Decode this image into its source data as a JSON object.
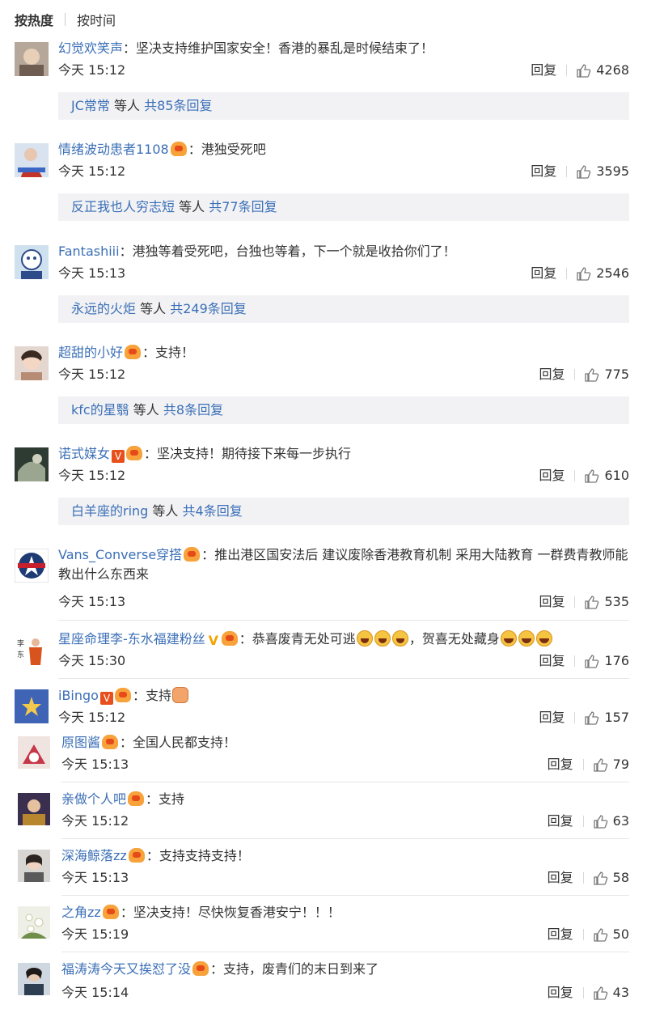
{
  "sort": {
    "hot_label": "按热度",
    "time_label": "按时间"
  },
  "reply_label": "回复",
  "comments": [
    {
      "nick": "幻觉欢笑声",
      "text": "坚决支持维护国家安全！香港的暴乱是时候结束了！",
      "time": "今天 15:12",
      "likes": "4268",
      "sub": {
        "user": "JC常常",
        "mid": " 等人 ",
        "count": "共85条回复"
      }
    },
    {
      "nick": "情绪波动患者1108",
      "text": "港独受死吧",
      "time": "今天 15:12",
      "likes": "3595",
      "sub": {
        "user": "反正我也人穷志短",
        "mid": " 等人 ",
        "count": "共77条回复"
      }
    },
    {
      "nick": "Fantashiii",
      "text": "港独等着受死吧，台独也等着，下一个就是收拾你们了！",
      "time": "今天 15:13",
      "likes": "2546",
      "sub": {
        "user": "永远的火炬",
        "mid": " 等人 ",
        "count": "共249条回复"
      }
    },
    {
      "nick": "超甜的小好",
      "text": "支持！",
      "time": "今天 15:12",
      "likes": "775",
      "sub": {
        "user": "kfc的星翳",
        "mid": " 等人 ",
        "count": "共8条回复"
      }
    },
    {
      "nick": "诺式媒女",
      "text": "坚决支持！期待接下来每一步执行",
      "time": "今天 15:12",
      "likes": "610",
      "sub": {
        "user": "白羊座的ring",
        "mid": " 等人 ",
        "count": "共4条回复"
      }
    },
    {
      "nick": "Vans_Converse穿搭",
      "text": "推出港区国安法后 建议废除香港教育机制 采用大陆教育 一群费青教师能教出什么东西来",
      "time": "今天 15:13",
      "likes": "535"
    },
    {
      "nick": "星座命理李-东水福建粉丝",
      "text_a": "恭喜废青无处可逃",
      "text_b": "，贺喜无处藏身",
      "time": "今天 15:30",
      "likes": "176"
    },
    {
      "nick": "iBingo",
      "text": "支持",
      "time": "今天 15:12",
      "likes": "157"
    },
    {
      "nick": "原图酱",
      "text": "全国人民都支持！",
      "time": "今天 15:13",
      "likes": "79"
    },
    {
      "nick": "亲做个人吧",
      "text": "支持",
      "time": "今天 15:12",
      "likes": "63"
    },
    {
      "nick": "深海鲸落zz",
      "text": "支持支持支持！",
      "time": "今天 15:13",
      "likes": "58"
    },
    {
      "nick": "之角zz",
      "text": "坚决支持！尽快恢复香港安宁！！！",
      "time": "今天 15:19",
      "likes": "50"
    },
    {
      "nick": "福涛涛今天又挨怼了没",
      "text": "支持，废青们的末日到来了",
      "time": "今天 15:14",
      "likes": "43"
    }
  ],
  "colors": {
    "link": "#3b6fb6",
    "sub_bg": "#f2f2f5",
    "badge": "#f7a23a",
    "vip": "#e7501d"
  }
}
